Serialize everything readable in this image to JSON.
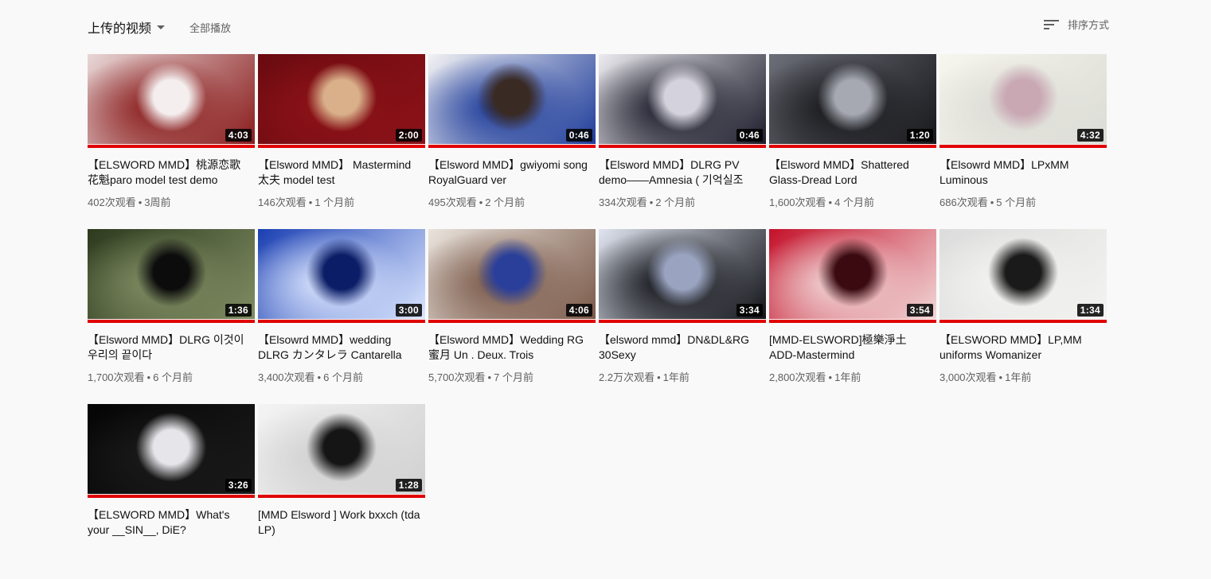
{
  "header": {
    "title": "上传的视频",
    "play_all": "全部播放",
    "sort_label": "排序方式"
  },
  "accent_color": "#e00000",
  "videos": [
    {
      "title": "【ELSWORD MMD】桃源恋歌 花魁paro model test demo",
      "duration": "4:03",
      "views": "402次观看",
      "age": "3周前",
      "thumb": [
        "#e8d6d6",
        "#8a1c1c",
        "#f4eeee"
      ]
    },
    {
      "title": "【Elsword MMD】 Mastermind 太夫 model test",
      "duration": "2:00",
      "views": "146次观看",
      "age": "1 个月前",
      "thumb": [
        "#6a0b10",
        "#8c1218",
        "#d9b08a"
      ]
    },
    {
      "title": "【Elsword MMD】gwiyomi song RoyalGuard ver",
      "duration": "0:46",
      "views": "495次观看",
      "age": "2 个月前",
      "thumb": [
        "#f2f2f4",
        "#1e3c9a",
        "#3a2a24"
      ]
    },
    {
      "title": "【Elsword MMD】DLRG PV demo——Amnesia ( 기억실조",
      "duration": "0:46",
      "views": "334次观看",
      "age": "2 个月前",
      "thumb": [
        "#ecebf0",
        "#1b1b2a",
        "#d4d2dc"
      ]
    },
    {
      "title": "【Elsword MMD】Shattered Glass-Dread Lord",
      "duration": "1:20",
      "views": "1,600次观看",
      "age": "4 个月前",
      "thumb": [
        "#6c6f78",
        "#18181c",
        "#a6a9b2"
      ]
    },
    {
      "title": "【Elsowrd MMD】LPxMM Luminous",
      "duration": "4:32",
      "views": "686次观看",
      "age": "5 个月前",
      "thumb": [
        "#f6f6ee",
        "#dcdcd6",
        "#c9a8b4"
      ]
    },
    {
      "title": "【Elsword MMD】DLRG 이것이 우리의 끝이다",
      "duration": "1:36",
      "views": "1,700次观看",
      "age": "6 个月前",
      "thumb": [
        "#2d3a1e",
        "#7f8c62",
        "#0c0c0c"
      ]
    },
    {
      "title": "【Elsowrd MMD】wedding DLRG カンタレラ Cantarella",
      "duration": "3:00",
      "views": "3,400次观看",
      "age": "6 个月前",
      "thumb": [
        "#1a3fb2",
        "#dbe6ff",
        "#0b1d66"
      ]
    },
    {
      "title": "【Elsword MMD】Wedding RG 蜜月 Un . Deux. Trois",
      "duration": "4:06",
      "views": "5,700次观看",
      "age": "7 个月前",
      "thumb": [
        "#e9e3dc",
        "#7b5a4a",
        "#2a3f9a"
      ]
    },
    {
      "title": "【elsword mmd】DN&DL&RG 30Sexy",
      "duration": "3:34",
      "views": "2.2万次观看",
      "age": "1年前",
      "thumb": [
        "#dfe4ef",
        "#111318",
        "#9aa4c0"
      ]
    },
    {
      "title": "[MMD-ELSWORD]極樂淨土 ADD-Mastermind",
      "duration": "3:54",
      "views": "2,800次观看",
      "age": "1年前",
      "thumb": [
        "#c4112a",
        "#f1d7d7",
        "#3a0a10"
      ]
    },
    {
      "title": "【ELSWORD MMD】LP,MM uniforms Womanizer",
      "duration": "1:34",
      "views": "3,000次观看",
      "age": "1年前",
      "thumb": [
        "#dcdcdc",
        "#f3f3f1",
        "#1a1a1a"
      ]
    },
    {
      "title": "【ELSWORD MMD】What's your __SIN__, DiE?",
      "duration": "3:26",
      "views": "",
      "age": "",
      "thumb": [
        "#050505",
        "#1a1a1a",
        "#e6e6ea"
      ]
    },
    {
      "title": "[MMD Elsword ] Work bxxch (tda LP)",
      "duration": "1:28",
      "views": "",
      "age": "",
      "thumb": [
        "#f4f4f4",
        "#d0d0d0",
        "#151515"
      ]
    }
  ]
}
